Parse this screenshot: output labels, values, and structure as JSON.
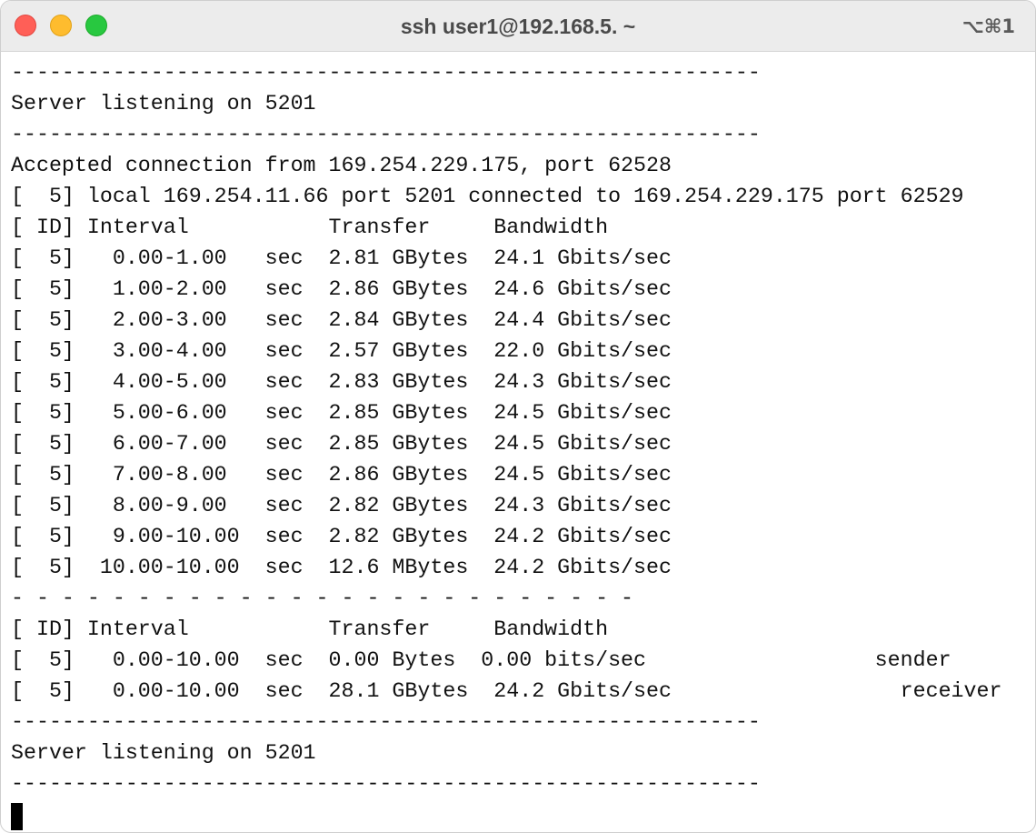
{
  "window": {
    "title": "ssh user1@192.168.5. ~",
    "shortcut": "⌥⌘1"
  },
  "terminal": {
    "lines": [
      "-----------------------------------------------------------",
      "Server listening on 5201",
      "-----------------------------------------------------------",
      "Accepted connection from 169.254.229.175, port 62528",
      "[  5] local 169.254.11.66 port 5201 connected to 169.254.229.175 port 62529",
      "[ ID] Interval           Transfer     Bandwidth",
      "[  5]   0.00-1.00   sec  2.81 GBytes  24.1 Gbits/sec",
      "[  5]   1.00-2.00   sec  2.86 GBytes  24.6 Gbits/sec",
      "[  5]   2.00-3.00   sec  2.84 GBytes  24.4 Gbits/sec",
      "[  5]   3.00-4.00   sec  2.57 GBytes  22.0 Gbits/sec",
      "[  5]   4.00-5.00   sec  2.83 GBytes  24.3 Gbits/sec",
      "[  5]   5.00-6.00   sec  2.85 GBytes  24.5 Gbits/sec",
      "[  5]   6.00-7.00   sec  2.85 GBytes  24.5 Gbits/sec",
      "[  5]   7.00-8.00   sec  2.86 GBytes  24.5 Gbits/sec",
      "[  5]   8.00-9.00   sec  2.82 GBytes  24.3 Gbits/sec",
      "[  5]   9.00-10.00  sec  2.82 GBytes  24.2 Gbits/sec",
      "[  5]  10.00-10.00  sec  12.6 MBytes  24.2 Gbits/sec",
      "- - - - - - - - - - - - - - - - - - - - - - - - -",
      "[ ID] Interval           Transfer     Bandwidth",
      "[  5]   0.00-10.00  sec  0.00 Bytes  0.00 bits/sec                  sender",
      "[  5]   0.00-10.00  sec  28.1 GBytes  24.2 Gbits/sec                  receiver",
      "-----------------------------------------------------------",
      "Server listening on 5201",
      "-----------------------------------------------------------"
    ]
  }
}
